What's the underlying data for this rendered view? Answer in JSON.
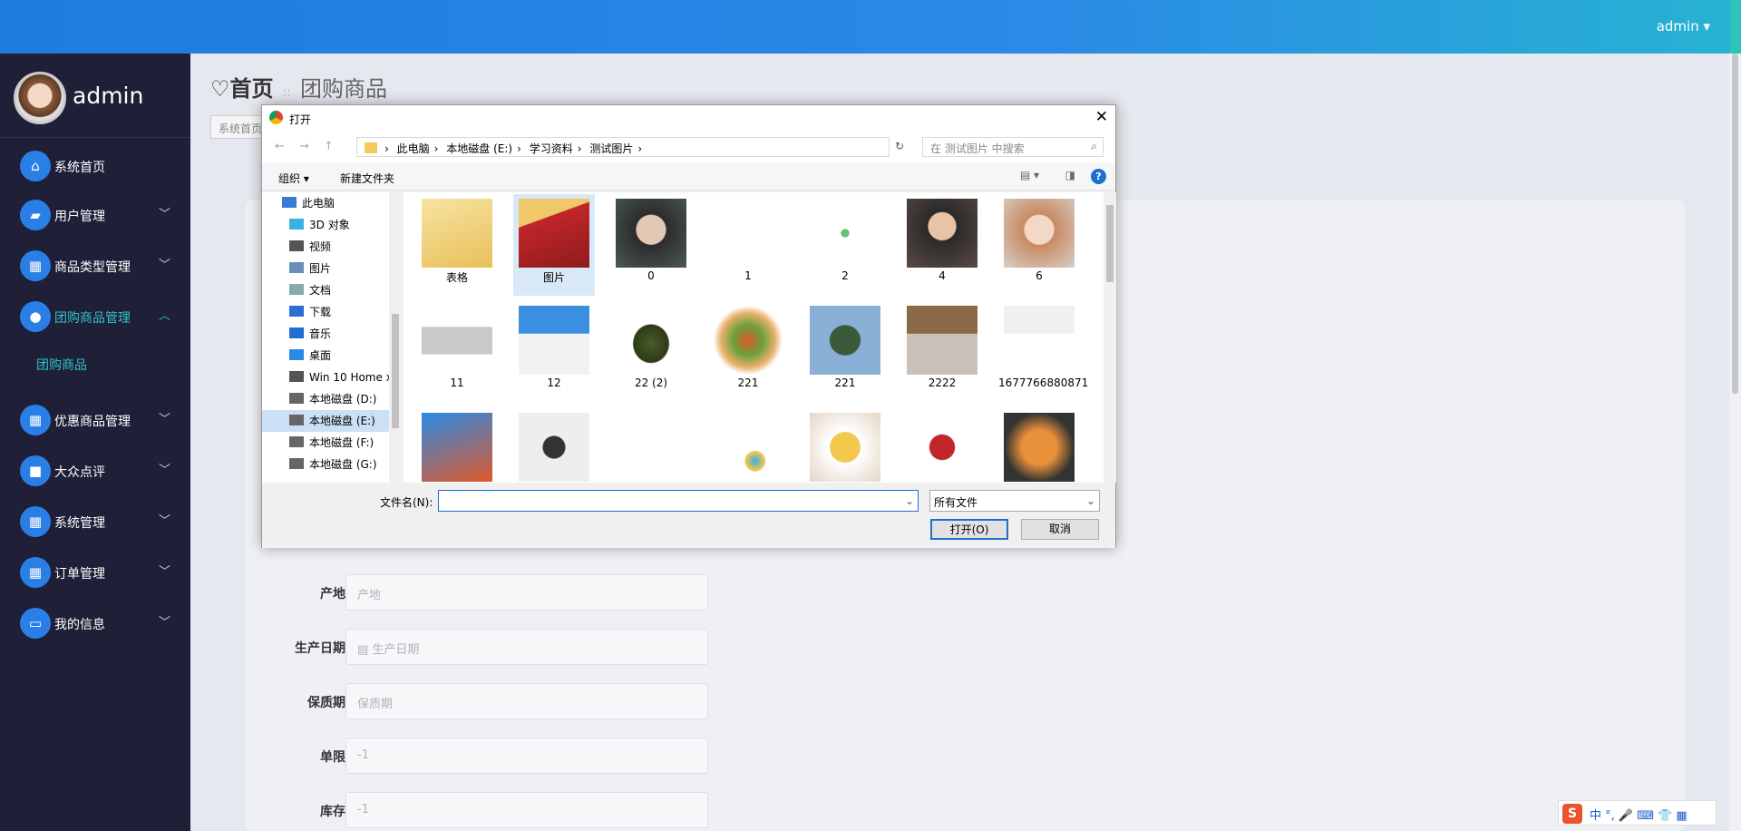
{
  "topbar": {
    "user": "admin ▾"
  },
  "sidebar": {
    "username": "admin",
    "items": [
      {
        "label": "系统首页",
        "icon": "home-icon",
        "glyph": "⌂"
      },
      {
        "label": "用户管理",
        "icon": "user-card-icon",
        "glyph": "▰"
      },
      {
        "label": "商品类型管理",
        "icon": "grid-icon",
        "glyph": "▦"
      },
      {
        "label": "团购商品管理",
        "icon": "person-icon",
        "glyph": "●"
      },
      {
        "label": "优惠商品管理",
        "icon": "grid-icon",
        "glyph": "▦"
      },
      {
        "label": "大众点评",
        "icon": "briefcase-icon",
        "glyph": "■"
      },
      {
        "label": "系统管理",
        "icon": "grid-icon",
        "glyph": "▦"
      },
      {
        "label": "订单管理",
        "icon": "grid-icon",
        "glyph": "▦"
      },
      {
        "label": "我的信息",
        "icon": "card-icon",
        "glyph": "▭"
      }
    ],
    "submenu": "团购商品"
  },
  "breadcrumb": {
    "home": "首页",
    "current": "团购商品"
  },
  "tab": "系统首页",
  "form": [
    {
      "label": "产地",
      "placeholder": "产地"
    },
    {
      "label": "生产日期",
      "placeholder": "▤ 生产日期"
    },
    {
      "label": "保质期",
      "placeholder": "保质期"
    },
    {
      "label": "单限",
      "placeholder": "-1"
    },
    {
      "label": "库存",
      "placeholder": "-1"
    }
  ],
  "ime": {
    "text": "中 °, 🎤 ⌨ 👕 ▦"
  },
  "dialog": {
    "title": "打开",
    "close": "✕",
    "nav": "← → ↑",
    "path": [
      "此电脑",
      "本地磁盘 (E:)",
      "学习资料",
      "测试图片"
    ],
    "search_placeholder": "在 测试图片 中搜索",
    "organize": "组织 ▾",
    "new_folder": "新建文件夹",
    "tree": [
      "此电脑",
      "3D 对象",
      "视频",
      "图片",
      "文档",
      "下载",
      "音乐",
      "桌面",
      "Win 10 Home x",
      "本地磁盘 (D:)",
      "本地磁盘 (E:)",
      "本地磁盘 (F:)",
      "本地磁盘 (G:)"
    ],
    "files": [
      "表格",
      "图片",
      "0",
      "1",
      "2",
      "4",
      "6",
      "11",
      "12",
      "22 (2)",
      "221",
      "221",
      "2222",
      "1677766880871",
      "",
      "",
      "",
      "",
      "",
      "",
      ""
    ],
    "filename_label": "文件名(N):",
    "filename_value": "",
    "filetype": "所有文件",
    "open_label": "打开(O)",
    "cancel_label": "取消"
  }
}
